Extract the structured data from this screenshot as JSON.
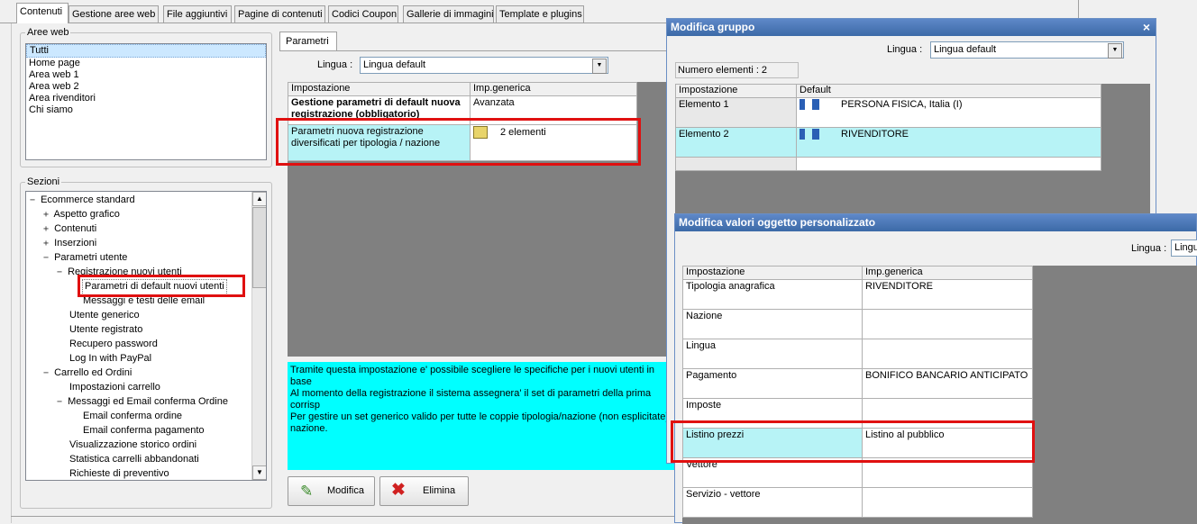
{
  "tabs": [
    "Contenuti",
    "Gestione aree web",
    "File aggiuntivi",
    "Pagine di contenuti",
    "Codici Coupon",
    "Gallerie di immagini",
    "Template e plugins"
  ],
  "aree_web": {
    "label": "Aree web",
    "items": [
      "Tutti",
      "Home page",
      "Area web 1",
      "Area web 2",
      "Area rivenditori",
      "Chi siamo"
    ]
  },
  "sezioni": {
    "label": "Sezioni",
    "tree": [
      {
        "text": "Ecommerce standard",
        "exp": "−"
      },
      {
        "text": "Aspetto grafico",
        "exp": "+"
      },
      {
        "text": "Contenuti",
        "exp": "+"
      },
      {
        "text": "Inserzioni",
        "exp": "+"
      },
      {
        "text": "Parametri utente",
        "exp": "−"
      },
      {
        "text": "Registrazione nuovi utenti",
        "exp": "−"
      },
      {
        "text": "Parametri di default nuovi utenti",
        "exp": ""
      },
      {
        "text": "Messaggi e testi delle email",
        "exp": ""
      },
      {
        "text": "Utente generico",
        "exp": ""
      },
      {
        "text": "Utente registrato",
        "exp": ""
      },
      {
        "text": "Recupero password",
        "exp": ""
      },
      {
        "text": "Log In with PayPal",
        "exp": ""
      },
      {
        "text": "Carrello ed Ordini",
        "exp": "−"
      },
      {
        "text": "Impostazioni carrello",
        "exp": ""
      },
      {
        "text": "Messaggi ed Email conferma Ordine",
        "exp": "−"
      },
      {
        "text": "Email conferma ordine",
        "exp": ""
      },
      {
        "text": "Email conferma pagamento",
        "exp": ""
      },
      {
        "text": "Visualizzazione storico ordini",
        "exp": ""
      },
      {
        "text": "Statistica carrelli abbandonati",
        "exp": ""
      },
      {
        "text": "Richieste di preventivo",
        "exp": ""
      }
    ]
  },
  "parametri": {
    "tab": "Parametri",
    "lingua_label": "Lingua :",
    "lingua_value": "Lingua default",
    "col1": "Impostazione",
    "col2": "Imp.generica",
    "row1_label": "Gestione parametri di default nuova registrazione (obbligatorio)",
    "row1_value": "Avanzata",
    "row2_label": "Parametri nuova registrazione diversificati per tipologia / nazione",
    "row2_value": "2 elementi",
    "info_lines": [
      "Tramite questa impostazione e' possibile scegliere le specifiche per i nuovi utenti in base",
      "Al momento della registrazione il sistema assegnera' il set di parametri della prima corrisp",
      "Per gestire un set generico valido per tutte le coppie tipologia/nazione (non esplicitate)",
      "nazione."
    ],
    "btn_modifica": "Modifica",
    "btn_elimina": "Elimina"
  },
  "modifica_gruppo": {
    "title": "Modifica gruppo",
    "close": "×",
    "lingua_label": "Lingua :",
    "lingua_value": "Lingua default",
    "numero": "Numero elementi : 2",
    "col1": "Impostazione",
    "col2": "Default",
    "rows": [
      {
        "label": "Elemento 1",
        "value": "PERSONA FISICA, Italia (I)"
      },
      {
        "label": "Elemento 2",
        "value": "RIVENDITORE"
      }
    ]
  },
  "modifica_valori": {
    "title": "Modifica valori oggetto personalizzato",
    "lingua_label": "Lingua :",
    "lingua_value": "Lingua",
    "col1": "Impostazione",
    "col2": "Imp.generica",
    "rows": [
      {
        "label": "Tipologia anagrafica",
        "value": "RIVENDITORE"
      },
      {
        "label": "Nazione",
        "value": ""
      },
      {
        "label": "Lingua",
        "value": ""
      },
      {
        "label": "Pagamento",
        "value": "BONIFICO BANCARIO ANTICIPATO"
      },
      {
        "label": "Imposte",
        "value": ""
      },
      {
        "label": "Listino prezzi",
        "value": "Listino al pubblico"
      },
      {
        "label": "Vettore",
        "value": ""
      },
      {
        "label": "Servizio - vettore",
        "value": ""
      }
    ]
  }
}
